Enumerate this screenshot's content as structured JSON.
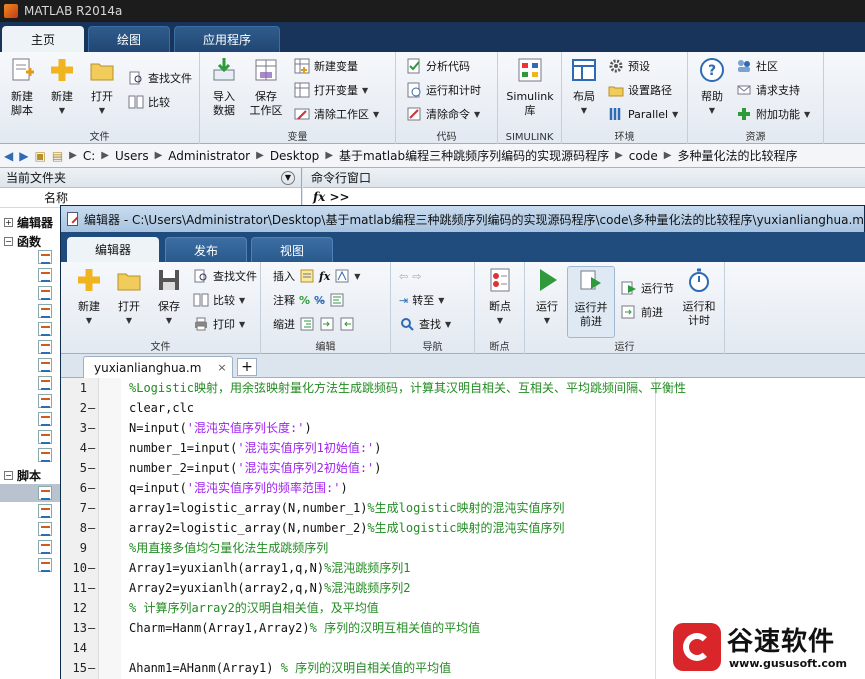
{
  "window": {
    "title": "MATLAB R2014a"
  },
  "main_tabs": [
    "主页",
    "绘图",
    "应用程序"
  ],
  "ribbon": {
    "file": {
      "label": "文件",
      "new_script": "新建\n脚本",
      "new": "新建",
      "open": "打开",
      "find_files": "查找文件",
      "compare": "比较"
    },
    "variable": {
      "label": "变量",
      "import": "导入\n数据",
      "save_ws": "保存\n工作区",
      "new_var": "新建变量",
      "open_var": "打开变量",
      "clear_ws": "清除工作区"
    },
    "code": {
      "label": "代码",
      "analyze": "分析代码",
      "run_time": "运行和计时",
      "clear_cmd": "清除命令"
    },
    "simulink": {
      "label": "SIMULINK",
      "lib": "Simulink\n库"
    },
    "env": {
      "label": "环境",
      "layout": "布局",
      "prefs": "预设",
      "set_path": "设置路径",
      "parallel": "Parallel"
    },
    "resources": {
      "label": "资源",
      "help": "帮助",
      "community": "社区",
      "support": "请求支持",
      "addons": "附加功能"
    }
  },
  "address": {
    "crumbs": [
      "C:",
      "Users",
      "Administrator",
      "Desktop",
      "基于matlab编程三种跳频序列编码的实现源码程序",
      "code",
      "多种量化法的比较程序"
    ]
  },
  "left_panel": {
    "title": "当前文件夹",
    "column": "名称",
    "groups": [
      "编辑器",
      "函数",
      "脚本"
    ]
  },
  "command_window": {
    "title": "命令行窗口",
    "prompt": "fx >>"
  },
  "editor": {
    "title": "编辑器 - C:\\Users\\Administrator\\Desktop\\基于matlab编程三种跳频序列编码的实现源码程序\\code\\多种量化法的比较程序\\yuxianlianghua.m",
    "tabs": [
      "编辑器",
      "发布",
      "视图"
    ],
    "ribbon": {
      "file_label": "文件",
      "new": "新建",
      "open": "打开",
      "save": "保存",
      "find_files": "查找文件",
      "compare": "比较",
      "print": "打印",
      "edit_label": "编辑",
      "insert": "插入",
      "comment": "注释",
      "indent": "缩进",
      "nav_label": "导航",
      "goto": "转至",
      "find": "查找",
      "bp_label": "断点",
      "breakpoints": "断点",
      "run_label": "运行",
      "run": "运行",
      "run_advance": "运行并\n前进",
      "run_section": "运行节",
      "advance": "前进",
      "run_time": "运行和\n计时"
    },
    "doc_tab": "yuxianlianghua.m",
    "code_lines": [
      {
        "n": "1",
        "dash": "",
        "parts": [
          [
            "cm",
            "%Logistic映射，用余弦映射量化方法生成跳频码，计算其汉明自相关、互相关、平均跳频间隔、平衡性"
          ]
        ]
      },
      {
        "n": "2",
        "dash": "—",
        "parts": [
          [
            "kw",
            "clear,clc"
          ]
        ]
      },
      {
        "n": "3",
        "dash": "—",
        "parts": [
          [
            "kw",
            "N=input("
          ],
          [
            "str",
            "'混沌实值序列长度:'"
          ],
          [
            "kw",
            ")"
          ]
        ]
      },
      {
        "n": "4",
        "dash": "—",
        "parts": [
          [
            "kw",
            "number_1=input("
          ],
          [
            "str",
            "'混沌实值序列1初始值:'"
          ],
          [
            "kw",
            ")"
          ]
        ]
      },
      {
        "n": "5",
        "dash": "—",
        "parts": [
          [
            "kw",
            "number_2=input("
          ],
          [
            "str",
            "'混沌实值序列2初始值:'"
          ],
          [
            "kw",
            ")"
          ]
        ]
      },
      {
        "n": "6",
        "dash": "—",
        "parts": [
          [
            "kw",
            "q=input("
          ],
          [
            "str",
            "'混沌实值序列的频率范围:'"
          ],
          [
            "kw",
            ")"
          ]
        ]
      },
      {
        "n": "7",
        "dash": "—",
        "parts": [
          [
            "kw",
            "array1=logistic_array(N,number_1)"
          ],
          [
            "cm",
            "%生成logistic映射的混沌实值序列"
          ]
        ]
      },
      {
        "n": "8",
        "dash": "—",
        "parts": [
          [
            "kw",
            "array2=logistic_array(N,number_2)"
          ],
          [
            "cm",
            "%生成logistic映射的混沌实值序列"
          ]
        ]
      },
      {
        "n": "9",
        "dash": "",
        "parts": [
          [
            "cm",
            "%用直接多值均匀量化法生成跳频序列"
          ]
        ]
      },
      {
        "n": "10",
        "dash": "—",
        "parts": [
          [
            "kw",
            "Array1=yuxianlh(array1,q,N)"
          ],
          [
            "cm",
            "%混沌跳频序列1"
          ]
        ]
      },
      {
        "n": "11",
        "dash": "—",
        "parts": [
          [
            "kw",
            "Array2=yuxianlh(array2,q,N)"
          ],
          [
            "cm",
            "%混沌跳频序列2"
          ]
        ]
      },
      {
        "n": "12",
        "dash": "",
        "parts": [
          [
            "cm",
            "% 计算序列array2的汉明自相关值，及平均值"
          ]
        ]
      },
      {
        "n": "13",
        "dash": "—",
        "parts": [
          [
            "kw",
            "Charm=Hanm(Array1,Array2)"
          ],
          [
            "cm",
            "% 序列的汉明互相关值的平均值"
          ]
        ]
      },
      {
        "n": "14",
        "dash": "",
        "parts": []
      },
      {
        "n": "15",
        "dash": "—",
        "parts": [
          [
            "kw",
            "Ahanm1=AHanm(Array1) "
          ],
          [
            "cm",
            "% 序列的汉明自相关值的平均值"
          ]
        ]
      }
    ]
  },
  "watermark": {
    "name": "谷速软件",
    "url": "www.gususoft.com"
  },
  "colors": {
    "ribbon_tab_bg": "#18345a",
    "comment": "#228b22",
    "string": "#a020f0"
  }
}
